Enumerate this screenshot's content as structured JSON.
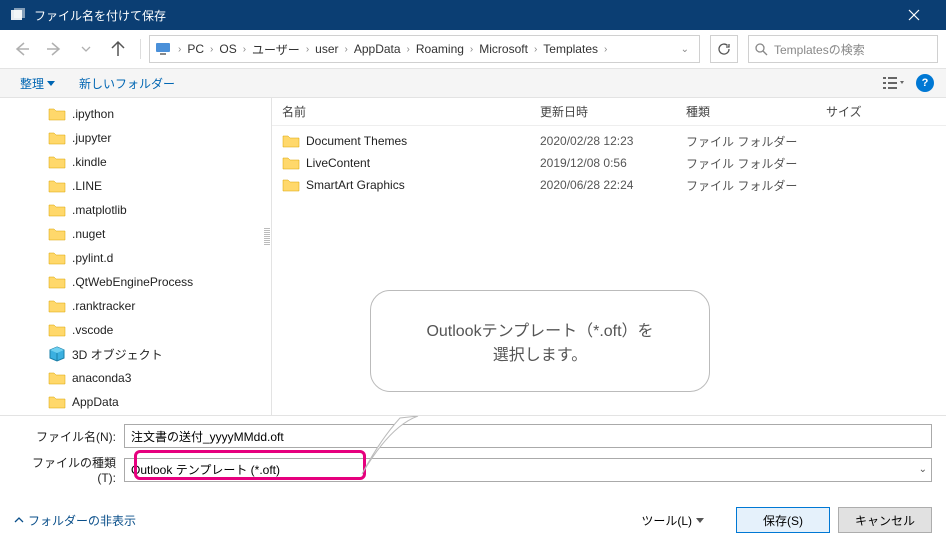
{
  "title": "ファイル名を付けて保存",
  "breadcrumb": [
    "PC",
    "OS",
    "ユーザー",
    "user",
    "AppData",
    "Roaming",
    "Microsoft",
    "Templates"
  ],
  "search": {
    "placeholder": "Templatesの検索"
  },
  "toolbar": {
    "organize": "整理",
    "newfolder": "新しいフォルダー"
  },
  "columns": {
    "name": "名前",
    "date": "更新日時",
    "type": "種類",
    "size": "サイズ"
  },
  "tree": [
    {
      "label": ".ipython",
      "icon": "folder"
    },
    {
      "label": ".jupyter",
      "icon": "folder"
    },
    {
      "label": ".kindle",
      "icon": "folder"
    },
    {
      "label": ".LINE",
      "icon": "folder"
    },
    {
      "label": ".matplotlib",
      "icon": "folder"
    },
    {
      "label": ".nuget",
      "icon": "folder"
    },
    {
      "label": ".pylint.d",
      "icon": "folder"
    },
    {
      "label": ".QtWebEngineProcess",
      "icon": "folder"
    },
    {
      "label": ".ranktracker",
      "icon": "folder"
    },
    {
      "label": ".vscode",
      "icon": "folder"
    },
    {
      "label": "3D オブジェクト",
      "icon": "3d"
    },
    {
      "label": "anaconda3",
      "icon": "folder"
    },
    {
      "label": "AppData",
      "icon": "folder"
    }
  ],
  "files": [
    {
      "name": "Document Themes",
      "date": "2020/02/28 12:23",
      "type": "ファイル フォルダー"
    },
    {
      "name": "LiveContent",
      "date": "2019/12/08 0:56",
      "type": "ファイル フォルダー"
    },
    {
      "name": "SmartArt Graphics",
      "date": "2020/06/28 22:24",
      "type": "ファイル フォルダー"
    }
  ],
  "filename": {
    "label": "ファイル名(N):",
    "value": "注文書の送付_yyyyMMdd.oft"
  },
  "filetype": {
    "label": "ファイルの種類(T):",
    "value": "Outlook テンプレート (*.oft)"
  },
  "hideFolders": "フォルダーの非表示",
  "toolsBtn": "ツール(L)",
  "saveBtn": "保存(S)",
  "cancelBtn": "キャンセル",
  "callout": {
    "line1": "Outlookテンプレート（*.oft）を",
    "line2": "選択します。"
  }
}
